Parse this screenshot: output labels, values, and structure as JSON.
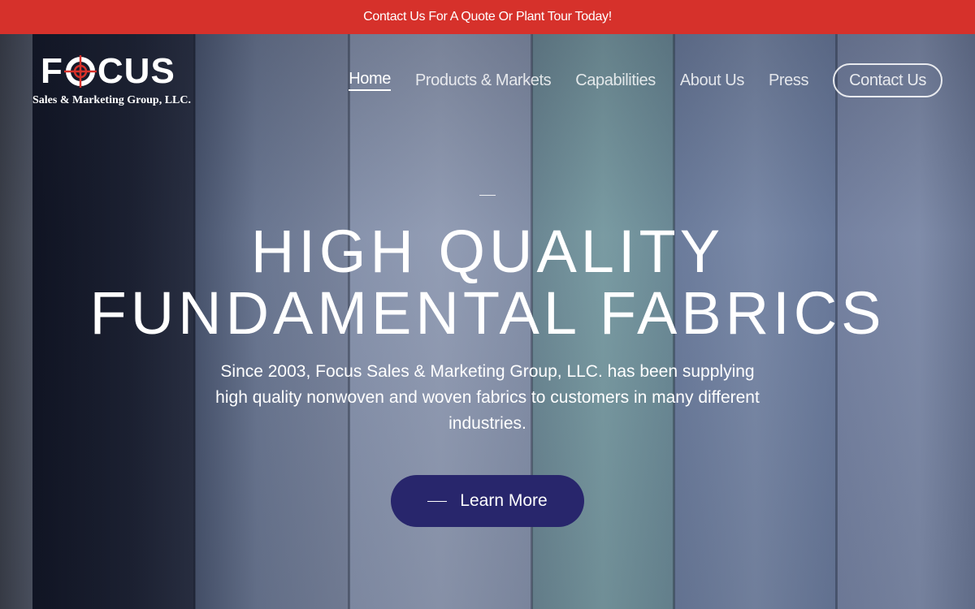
{
  "announcement": {
    "text": "Contact Us For A Quote Or Plant Tour Today!"
  },
  "brand": {
    "name_before": "F",
    "name_after": "CUS",
    "tagline": "Sales & Marketing Group, LLC.",
    "accent_color": "#d6312b"
  },
  "nav": {
    "items": [
      {
        "label": "Home",
        "active": true
      },
      {
        "label": "Products & Markets",
        "active": false
      },
      {
        "label": "Capabilities",
        "active": false
      },
      {
        "label": "About Us",
        "active": false
      },
      {
        "label": "Press",
        "active": false
      }
    ],
    "cta_label": "Contact Us"
  },
  "hero": {
    "headline_line1": "HIGH QUALITY",
    "headline_line2": "FUNDAMENTAL FABRICS",
    "description": "Since 2003, Focus Sales & Marketing Group, LLC. has been supplying high quality nonwoven and woven fabrics to customers in many different industries.",
    "button_label": "Learn More",
    "button_color": "#28266c"
  }
}
